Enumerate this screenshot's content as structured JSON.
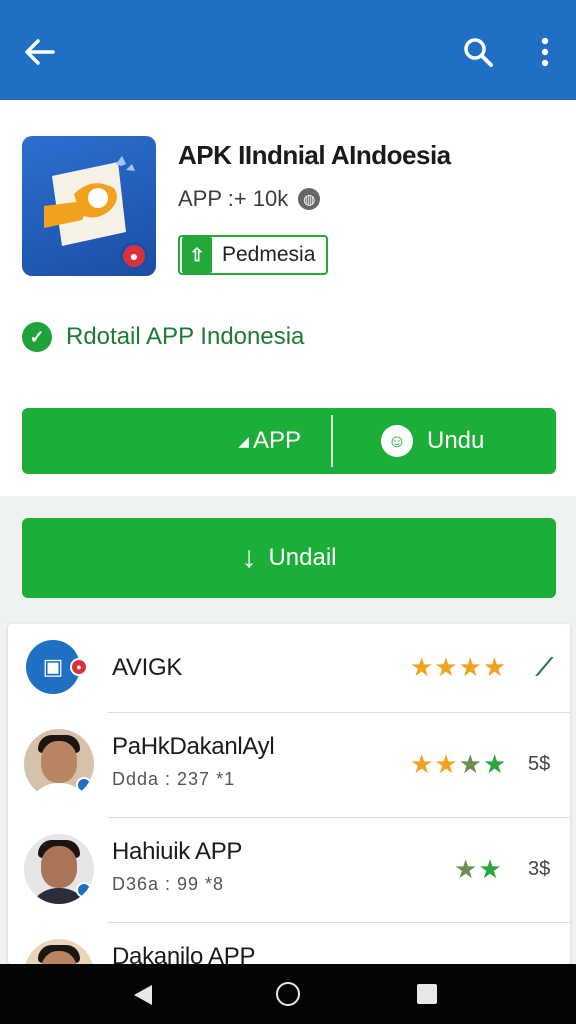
{
  "app_bar": {
    "color": "#1f6fc5",
    "icons": [
      "back-arrow-icon",
      "search-icon",
      "more-vert-icon"
    ]
  },
  "app": {
    "title": "APK IIndnial AIndoesia",
    "meta": "APP :+ 10k",
    "publisher": "Pedmesia",
    "verified_text": "Rdotail APP Indonesia"
  },
  "actions": {
    "split_left_label": "APP",
    "split_right_label": "Undu",
    "download_label": "Undail",
    "button_color": "#1bae38"
  },
  "reviews": [
    {
      "name": "AVIGK",
      "rating_text": "★★★★",
      "rating": 4,
      "count": "",
      "sub": ""
    },
    {
      "name": "PaHkDakanlAyl",
      "sub": "Ddda : 237 *1",
      "rating_text": "★★★★",
      "rating": 4,
      "count": "5$"
    },
    {
      "name": "Hahiuik APP",
      "sub": "D36a : 99 *8",
      "rating_text": "★★",
      "rating": 2,
      "count": "3$"
    },
    {
      "name": "Dakanilo APP",
      "sub": "",
      "rating_text": "",
      "rating": null,
      "count": ""
    }
  ],
  "nav_bar": {
    "icons": [
      "nav-back-icon",
      "nav-home-icon",
      "nav-recents-icon"
    ]
  }
}
